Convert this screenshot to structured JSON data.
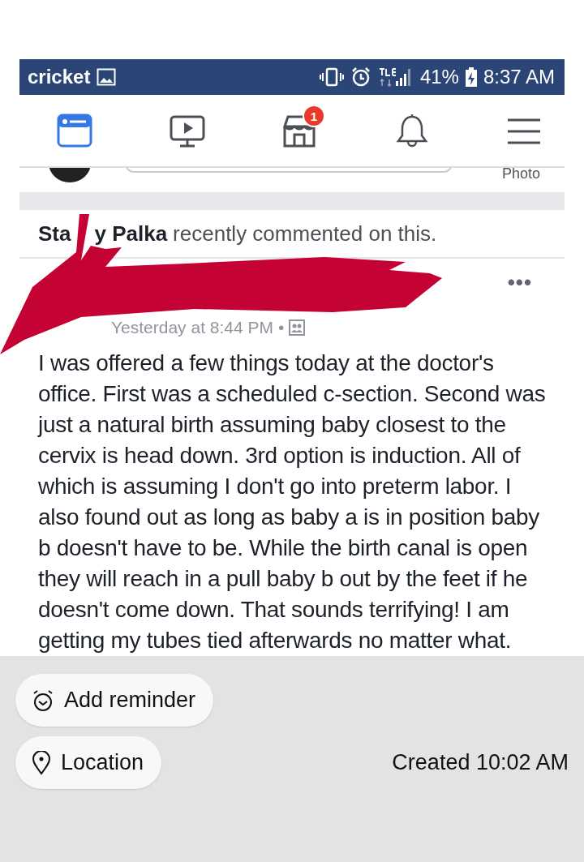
{
  "status_bar": {
    "carrier": "cricket",
    "battery": "41%",
    "time": "8:37 AM"
  },
  "nav": {
    "tabs": [
      {
        "kind": "feed",
        "selected": true
      },
      {
        "kind": "video",
        "selected": false
      },
      {
        "kind": "shop",
        "selected": false,
        "badge": "1"
      },
      {
        "kind": "bell",
        "selected": false
      },
      {
        "kind": "menu",
        "selected": false
      }
    ]
  },
  "composer": {
    "photo_label": "Photo"
  },
  "activity": {
    "name_parts": [
      "Sta",
      "y Palka"
    ],
    "text": "recently commented on this."
  },
  "post": {
    "more_label": "•••",
    "time": "Yesterday at 8:44 PM",
    "separator": "•",
    "body": "I was offered a few things today at the doctor's office. First was a scheduled c-section. Second was just a natural birth assuming baby closest to the cervix is head down. 3rd option is induction. All of which is assuming I don't go into preterm labor. I also found out as long as baby a is in position baby b doesn't have to be. While the birth canal is open they will reach in a pull baby b out by the feet if he doesn't come down. That sounds terrifying! I am getting my tubes tied afterwards no matter what."
  },
  "footer": {
    "buttons": [
      {
        "kind": "reminder",
        "label": "Add reminder"
      },
      {
        "kind": "location",
        "label": "Location"
      }
    ],
    "created": "Created 10:02 AM"
  }
}
